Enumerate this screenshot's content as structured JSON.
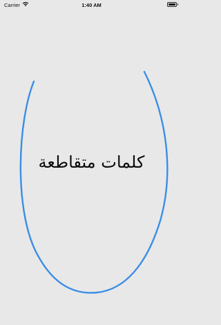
{
  "status_bar": {
    "carrier": "Carrier",
    "time": "1:40 AM",
    "wifi_icon": "wifi-icon",
    "battery_icon": "battery-icon",
    "battery_level": 1.0
  },
  "splash": {
    "title": "كلمات متقاطعة",
    "arc_color": "#3a8ee6",
    "background_color": "#e8e8e8"
  }
}
